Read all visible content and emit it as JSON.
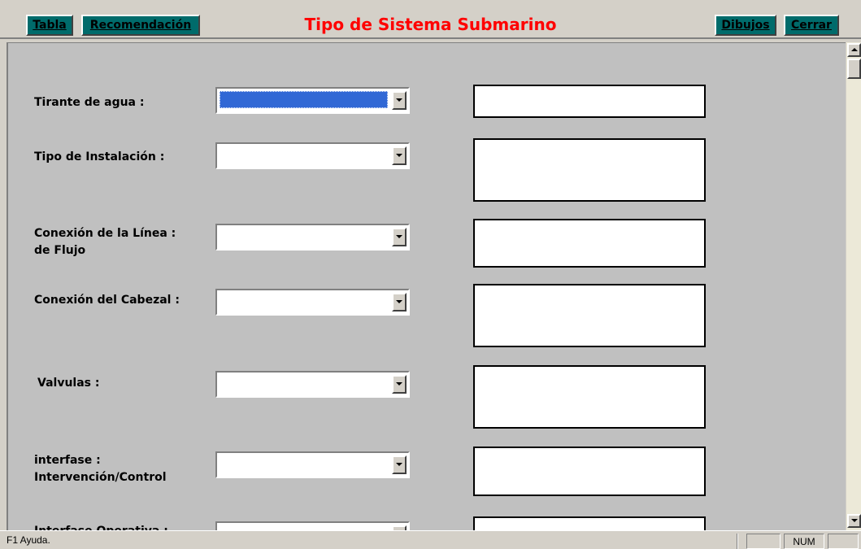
{
  "header": {
    "title": "Tipo de Sistema Submarino",
    "buttons": {
      "tabla": "Tabla",
      "recomendacion": "Recomendación",
      "dibujos": "Dibujos",
      "cerrar": "Cerrar"
    }
  },
  "form": {
    "rows": [
      {
        "label": "Tirante de agua :",
        "label2": ""
      },
      {
        "label": "Tipo de Instalación :",
        "label2": ""
      },
      {
        "label": "Conexión de la Línea :",
        "label2": "de Flujo"
      },
      {
        "label": "Conexión del Cabezal :",
        "label2": ""
      },
      {
        "label": "Valvulas :",
        "label2": ""
      },
      {
        "label": "interfase :",
        "label2": "Intervención/Control"
      },
      {
        "label": "Interfase Operativa :",
        "label2": ""
      }
    ]
  },
  "status_bar": {
    "message": "F1  Ayuda.",
    "num": "NUM"
  },
  "colors": {
    "button_bg": "#006b6b",
    "title_color": "#ff0000",
    "selection": "#3168d5"
  }
}
